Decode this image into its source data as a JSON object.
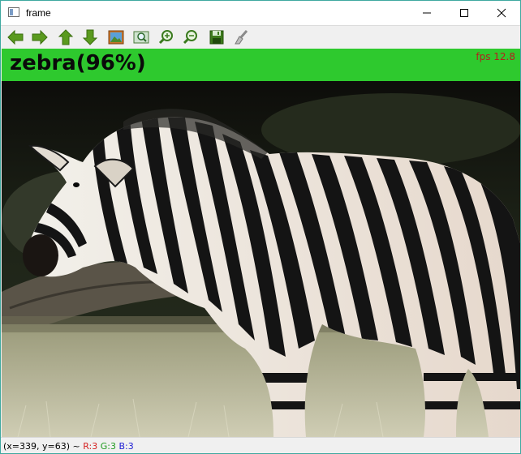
{
  "window": {
    "title": "frame",
    "controls": [
      "minimize",
      "maximize",
      "close"
    ]
  },
  "toolbar": {
    "buttons": [
      {
        "name": "pan-left",
        "icon": "arrow-left-icon"
      },
      {
        "name": "pan-right",
        "icon": "arrow-right-icon"
      },
      {
        "name": "pan-up",
        "icon": "arrow-up-icon"
      },
      {
        "name": "pan-down",
        "icon": "arrow-down-icon"
      },
      {
        "name": "zoom-original",
        "icon": "image-icon"
      },
      {
        "name": "zoom-fit",
        "icon": "zoom-window-icon"
      },
      {
        "name": "zoom-in",
        "icon": "zoom-in-icon"
      },
      {
        "name": "zoom-out",
        "icon": "zoom-out-icon"
      },
      {
        "name": "save",
        "icon": "floppy-icon"
      },
      {
        "name": "properties",
        "icon": "brush-icon"
      }
    ]
  },
  "overlay": {
    "label": "zebra(96%)",
    "fps": "fps  12.8",
    "bar_color": "#2ec92e",
    "label_color": "#0a0a0a",
    "fps_color": "#b41e1e"
  },
  "status": {
    "coords": "(x=339, y=63) ~",
    "r": "R:3",
    "g": "G:3",
    "b": "B:3"
  }
}
